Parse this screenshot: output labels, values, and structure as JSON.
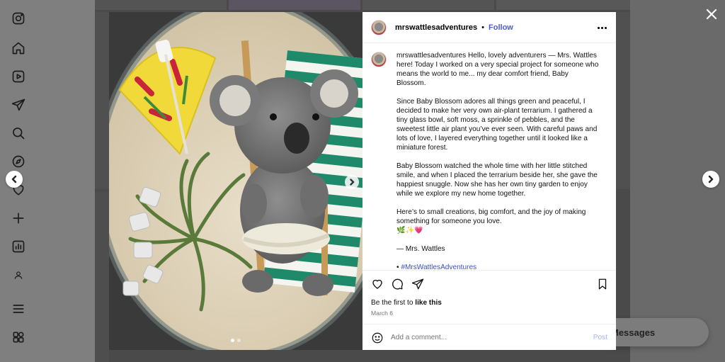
{
  "nav": {
    "icons": [
      "instagram-logo-icon",
      "home-icon",
      "reels-icon",
      "direct-icon",
      "search-icon",
      "explore-icon",
      "notifications-icon",
      "create-icon",
      "dashboard-icon",
      "profile-icon",
      "menu-icon",
      "also-from-meta-icon"
    ]
  },
  "post": {
    "username": "mrswattlesadventures",
    "follow_label": "Follow",
    "separator": "•",
    "caption_paragraphs": [
      "Hello, lovely adventurers — Mrs. Wattles here! Today I worked on a very special project for someone who means the world to me... my dear comfort friend, Baby Blossom.",
      "Since Baby Blossom adores all things green and peaceful, I decided to make her very own air-plant terrarium. I gathered a tiny glass bowl, soft moss, a sprinkle of pebbles, and the sweetest little air plant you’ve ever seen. With careful paws and lots of love, I layered everything together until it looked like a miniature forest.",
      "Baby Blossom watched the whole time with her little stitched smile, and when I placed the terrarium beside her, she gave the happiest snuggle. Now she has her own tiny garden to enjoy while we explore my new home together.",
      "Here’s to small creations, big comfort, and the joy of making something for someone you love.\n🌿✨💗",
      "— Mrs. Wattles"
    ],
    "hashtag_prefix": "•",
    "hashtag": "#MrsWattlesAdventures",
    "likes_prefix": "Be the first to",
    "likes_action": "like this",
    "date": "March 6",
    "comment_placeholder": "Add a comment...",
    "post_label": "Post"
  },
  "messages_label": "Messages",
  "colors": {
    "follow": "#4a5bd8",
    "hashtag": "#3b4fc8",
    "post_disabled": "#a8b4f0"
  }
}
